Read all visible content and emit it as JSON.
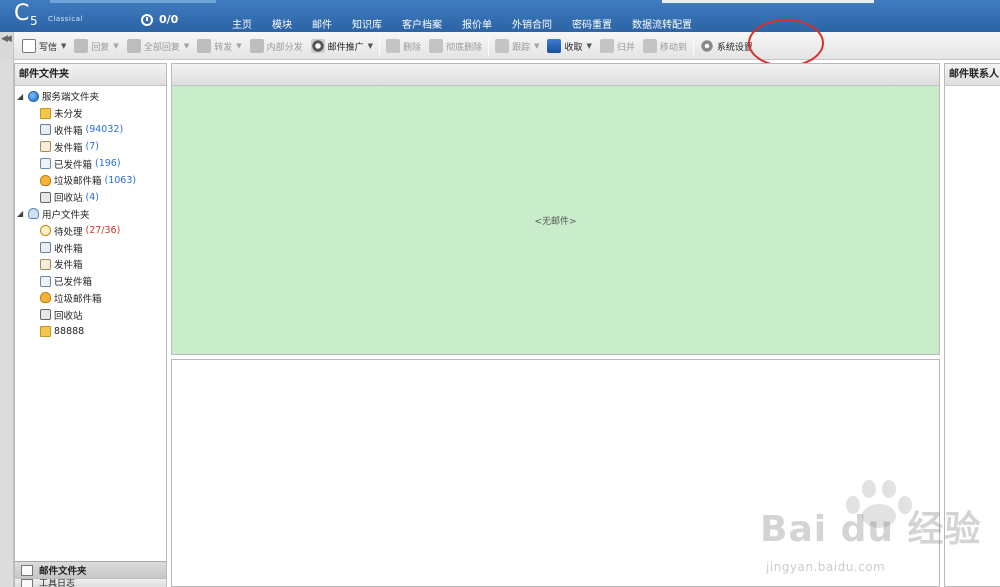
{
  "header": {
    "logo_c": "C",
    "logo_5": "5",
    "logo_sub": "Classical",
    "alarm_count": "0/0",
    "nav": [
      "主页",
      "模块",
      "邮件",
      "知识库",
      "客户档案",
      "报价单",
      "外销合同",
      "密码重置",
      "数据流转配置"
    ]
  },
  "toolbar": {
    "write": "写信",
    "reply": "回复",
    "reply_all": "全部回复",
    "forward": "转发",
    "internal_forward": "内部分发",
    "promotion": "邮件推广",
    "delete": "删除",
    "purge": "彻底删除",
    "track": "跟踪",
    "receive": "收取",
    "archive": "归并",
    "move_to": "移动到",
    "settings": "系统设置"
  },
  "folder_panel": {
    "title": "邮件文件夹",
    "server_root": "服务端文件夹",
    "server_folders": [
      {
        "label": "未分发",
        "count": ""
      },
      {
        "label": "收件箱",
        "count": "(94032)"
      },
      {
        "label": "发件箱",
        "count": "(7)"
      },
      {
        "label": "已发件箱",
        "count": "(196)"
      },
      {
        "label": "垃圾邮件箱",
        "count": "(1063)"
      },
      {
        "label": "回收站",
        "count": "(4)"
      }
    ],
    "user_root": "用户文件夹",
    "user_folders": [
      {
        "label": "待处理",
        "count": "(27/36)"
      },
      {
        "label": "收件箱",
        "count": ""
      },
      {
        "label": "发件箱",
        "count": ""
      },
      {
        "label": "已发件箱",
        "count": ""
      },
      {
        "label": "垃圾邮件箱",
        "count": ""
      },
      {
        "label": "回收站",
        "count": ""
      },
      {
        "label": "88888",
        "count": ""
      }
    ],
    "footer_tab1": "邮件文件夹",
    "footer_tab2": "工具日志"
  },
  "mail_list": {
    "empty_text": "<无邮件>"
  },
  "right_panel": {
    "title": "邮件联系人"
  },
  "watermark": {
    "brand": "Bai du 经验",
    "url": "jingyan.baidu.com"
  }
}
